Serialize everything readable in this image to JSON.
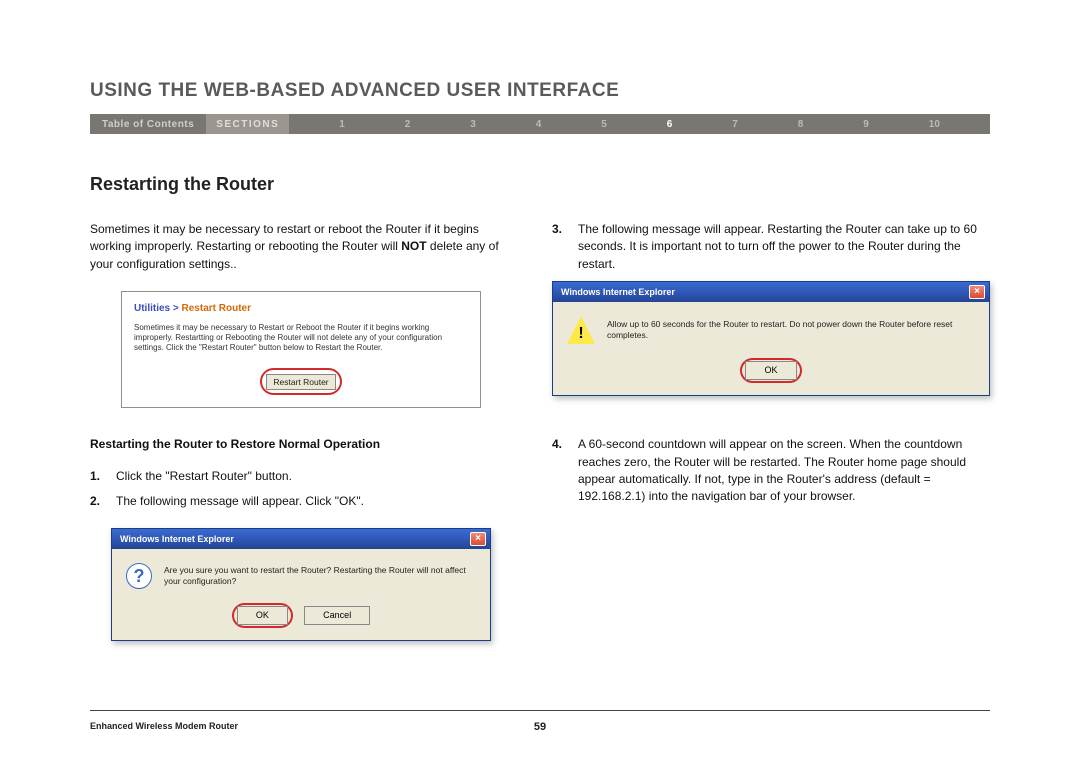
{
  "header": {
    "title": "USING THE WEB-BASED ADVANCED USER INTERFACE"
  },
  "nav": {
    "toc": "Table of Contents",
    "sections_label": "SECTIONS",
    "items": [
      "1",
      "2",
      "3",
      "4",
      "5",
      "6",
      "7",
      "8",
      "9",
      "10"
    ],
    "active": "6"
  },
  "section": {
    "heading": "Restarting the Router"
  },
  "left": {
    "intro_a": "Sometimes it may be necessary to restart or reboot the Router if it begins working improperly. Restarting or rebooting the Router will ",
    "intro_bold": "NOT",
    "intro_b": " delete any of your configuration settings..",
    "shot1": {
      "bc_utilities": "Utilities > ",
      "bc_restart": "Restart Router",
      "desc": "Sometimes it may be necessary to Restart or Reboot the Router if it begins working improperly. Restartting or Rebooting the Router will not delete any of your configuration settings. Click the \"Restart Router\" button below to Restart the Router.",
      "button": "Restart Router"
    },
    "sub_heading": "Restarting the Router to Restore Normal Operation",
    "step1_num": "1.",
    "step1_text": "Click the \"Restart Router\" button.",
    "step2_num": "2.",
    "step2_text": "The following message will appear. Click \"OK\".",
    "dlg2": {
      "title": "Windows Internet Explorer",
      "msg": "Are you sure you want to restart the Router? Restarting the Router will not affect your configuration?",
      "ok": "OK",
      "cancel": "Cancel"
    }
  },
  "right": {
    "step3_num": "3.",
    "step3_text": "The following message will appear. Restarting the Router can take up to 60 seconds. It is important not to turn off the power to the Router during the restart.",
    "dlg3": {
      "title": "Windows Internet Explorer",
      "msg": "Allow up to 60 seconds for the Router to restart. Do not power down the Router before reset completes.",
      "ok": "OK"
    },
    "step4_num": "4.",
    "step4_text": "A 60-second countdown will appear on the screen. When the countdown reaches zero, the Router will be restarted. The Router home page should appear automatically. If not, type in the Router's address (default = 192.168.2.1) into the navigation bar of your browser."
  },
  "footer": {
    "product": "Enhanced Wireless Modem Router",
    "page": "59"
  }
}
